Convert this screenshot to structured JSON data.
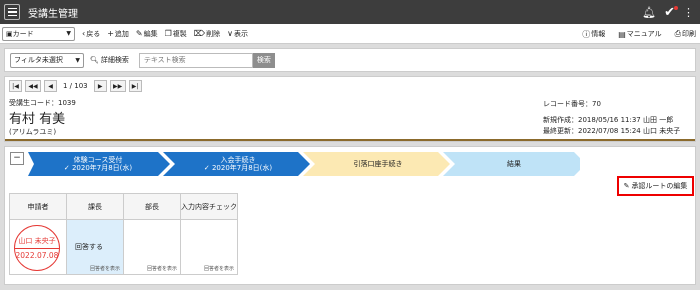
{
  "app": {
    "title": "受講生管理"
  },
  "header": {
    "icons": [
      "bell-icon",
      "check-icon",
      "more-vertical-icon"
    ]
  },
  "toolbar": {
    "view_select": "カード",
    "back": "戻る",
    "add": "追加",
    "edit": "編集",
    "copy": "複製",
    "delete": "削除",
    "display": "表示",
    "info": "情報",
    "manual": "マニュアル",
    "print": "印刷"
  },
  "search": {
    "filter_select": "フィルタ未選択",
    "advanced": "詳細検索",
    "placeholder": "テキスト検索",
    "button": "検索"
  },
  "record": {
    "page": "1 / 103",
    "code": "受講生コード：1039",
    "name": "有村 有美",
    "kana": "(アリムラユミ)",
    "record_no": "レコード番号：70",
    "created": "新規作成：2018/05/16 11:37 山田 一郎",
    "updated": "最終更新：2022/07/08 15:24 山口 未央子"
  },
  "process": {
    "collapse": "−",
    "steps": [
      {
        "label": "体験コース受付",
        "date": "2020年7月8日(水)"
      },
      {
        "label": "入会手続き",
        "date": "2020年7月8日(水)"
      },
      {
        "label": "引落口座手続き",
        "date": ""
      },
      {
        "label": "結果",
        "date": ""
      }
    ],
    "step_colors": {
      "done": "#1e73c8",
      "current": "#fce9b3",
      "pending": "#bfe3f7"
    },
    "approval_route": "承認ルートの編集"
  },
  "approval": {
    "columns": [
      "申請者",
      "課長",
      "部長",
      "入力内容チェック"
    ],
    "stamp_name": "山口 未央子",
    "stamp_date": "2022.07.08",
    "answer": "回答する",
    "viewer": "回答者を表示"
  }
}
